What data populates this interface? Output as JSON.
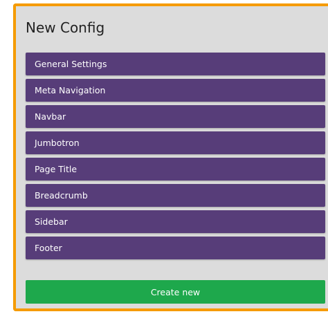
{
  "title": "New Config",
  "sections": [
    {
      "label": "General Settings"
    },
    {
      "label": "Meta Navigation"
    },
    {
      "label": "Navbar"
    },
    {
      "label": "Jumbotron"
    },
    {
      "label": "Page Title"
    },
    {
      "label": "Breadcrumb"
    },
    {
      "label": "Sidebar"
    },
    {
      "label": "Footer"
    }
  ],
  "create_button_label": "Create new",
  "colors": {
    "panel_border": "#f59b00",
    "panel_background": "#dcdcdc",
    "section_background": "#573d79",
    "create_button": "#1ea84c"
  }
}
